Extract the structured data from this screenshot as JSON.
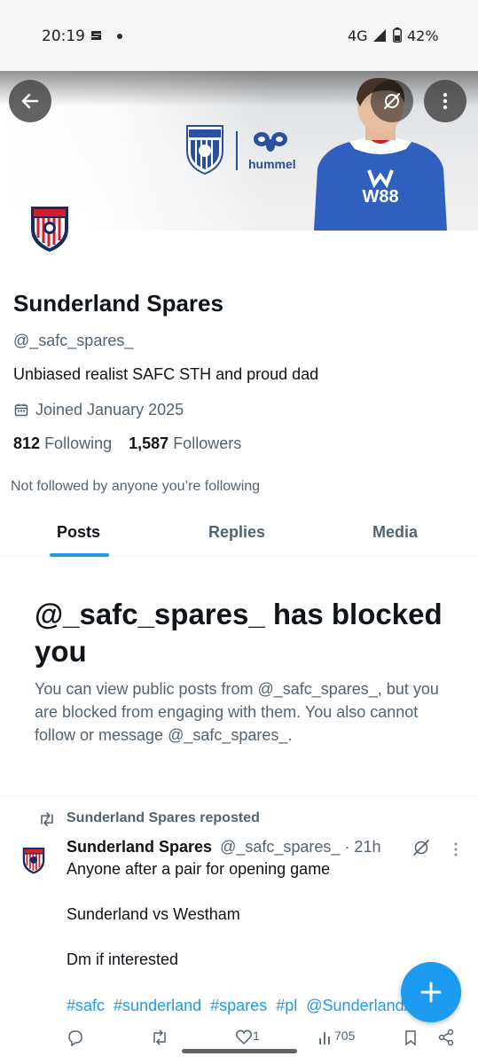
{
  "status_bar": {
    "time": "20:19",
    "network": "4G",
    "battery": "42%"
  },
  "banner": {
    "crest_text": "SUNDERLAND",
    "sponsor_logo": "hummel",
    "shirt_sponsor": "W88"
  },
  "profile": {
    "name": "Sunderland Spares",
    "handle": "@_safc_spares_",
    "bio": "Unbiased realist  SAFC STH and proud dad",
    "joined": "Joined January 2025",
    "following_count": "812",
    "following_label": "Following",
    "followers_count": "1,587",
    "followers_label": "Followers",
    "mutuals": "Not followed by anyone you’re following"
  },
  "tabs": [
    {
      "label": "Posts",
      "selected": true
    },
    {
      "label": "Replies",
      "selected": false
    },
    {
      "label": "Media",
      "selected": false
    }
  ],
  "blocked": {
    "title": "@_safc_spares_ has blocked you",
    "description": "You can view public posts from @_safc_spares_, but you are blocked from engaging with them. You also cannot follow or message @_safc_spares_."
  },
  "post": {
    "repost_label": "Sunderland Spares reposted",
    "author_name": "Sunderland Spares",
    "author_handle": "@_safc_spares_",
    "time": "· 21h",
    "line1": "Anyone after a pair for opening game",
    "line2": "Sunderland vs Westham",
    "line3": "Dm if interested",
    "hashtags": [
      "#safc",
      "#sunderland",
      "#spares",
      "#pl",
      "@SunderlandAFC"
    ],
    "likes": "1",
    "views": "705"
  },
  "colors": {
    "accent": "#1d9bf0",
    "text_primary": "#0f1419",
    "text_secondary": "#536471",
    "crest_red": "#d21f2b",
    "crest_navy": "#1a2a5e"
  },
  "icons": {
    "back": "arrow-left-icon",
    "grok": "grok-icon",
    "more": "more-vertical-icon",
    "calendar": "calendar-icon",
    "repost": "repost-icon",
    "compose": "plus-icon"
  }
}
